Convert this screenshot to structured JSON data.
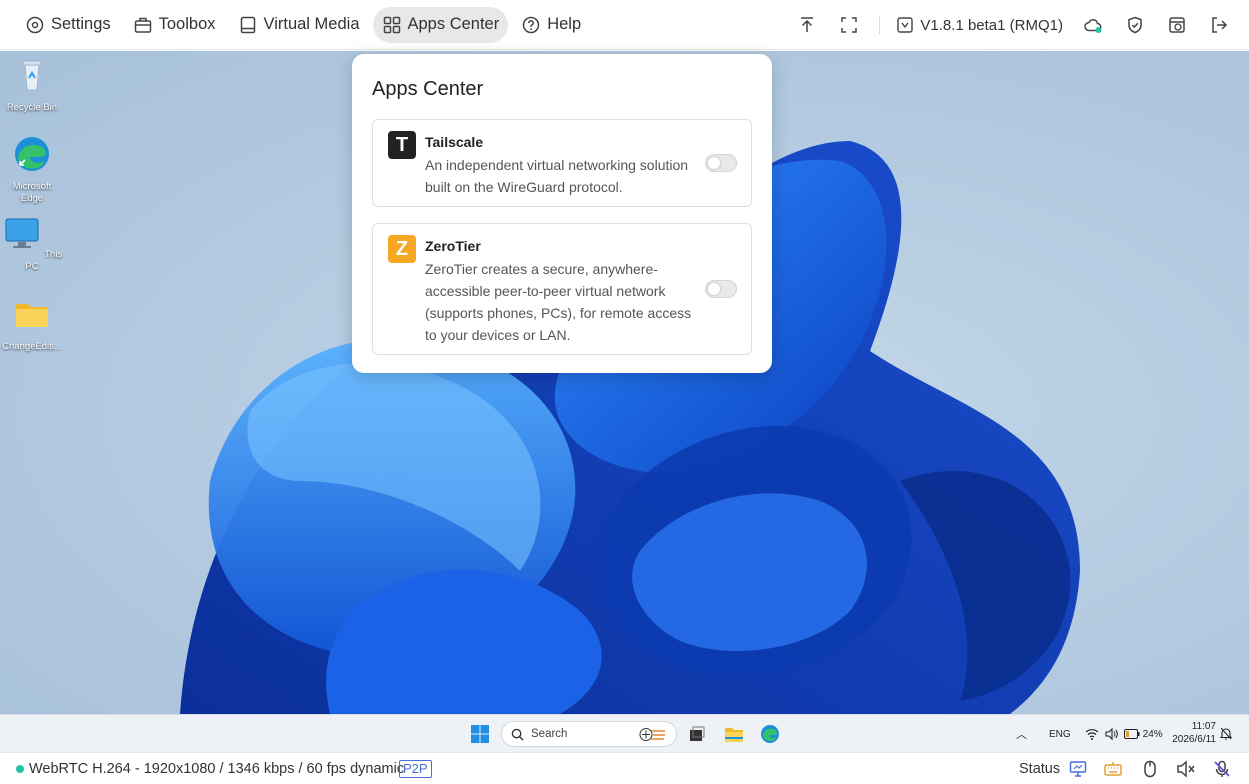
{
  "toolbar": {
    "items": [
      {
        "label": "Settings",
        "icon": "settings-icon"
      },
      {
        "label": "Toolbox",
        "icon": "toolbox-icon"
      },
      {
        "label": "Virtual Media",
        "icon": "virtual-media-icon"
      },
      {
        "label": "Apps Center",
        "icon": "apps-grid-icon",
        "active": true
      },
      {
        "label": "Help",
        "icon": "help-icon"
      }
    ],
    "version": "V1.8.1 beta1 (RMQ1)",
    "right_icons": [
      "upload-icon",
      "fullscreen-icon",
      "cloud-status-icon",
      "shield-icon",
      "power-cycle-icon",
      "logout-icon"
    ]
  },
  "desktop": {
    "icons": [
      {
        "label": "Recycle Bin",
        "icon": "recycle-bin-icon"
      },
      {
        "label": "Microsoft Edge",
        "icon": "edge-icon"
      },
      {
        "label": "This PC",
        "icon": "this-pc-icon"
      },
      {
        "label": "ChangeEditi...",
        "icon": "folder-icon"
      }
    ]
  },
  "apps_center": {
    "title": "Apps Center",
    "apps": [
      {
        "name": "Tailscale",
        "logo": "T",
        "logo_color": "#222222",
        "description": "An independent virtual networking solution built on the WireGuard protocol.",
        "enabled": false
      },
      {
        "name": "ZeroTier",
        "logo": "Z",
        "logo_color": "#f5a623",
        "description": "ZeroTier creates a secure, anywhere-accessible peer-to-peer virtual network (supports phones, PCs), for remote access to your devices or LAN.",
        "enabled": false
      }
    ]
  },
  "taskbar": {
    "search_placeholder": "Search",
    "language": "ENG",
    "battery": "24%",
    "time": "11:07",
    "date": "2026/6/11"
  },
  "statusbar": {
    "stream_info": "WebRTC H.264 - 1920x1080 /  1346 kbps / 60 fps dynamic",
    "mode_badge": "P2P",
    "status_label": "Status",
    "connection_color": "#22c3a0"
  },
  "colors": {
    "accent": "#4a6fd8",
    "active_tab_bg": "#e8e8e8"
  }
}
